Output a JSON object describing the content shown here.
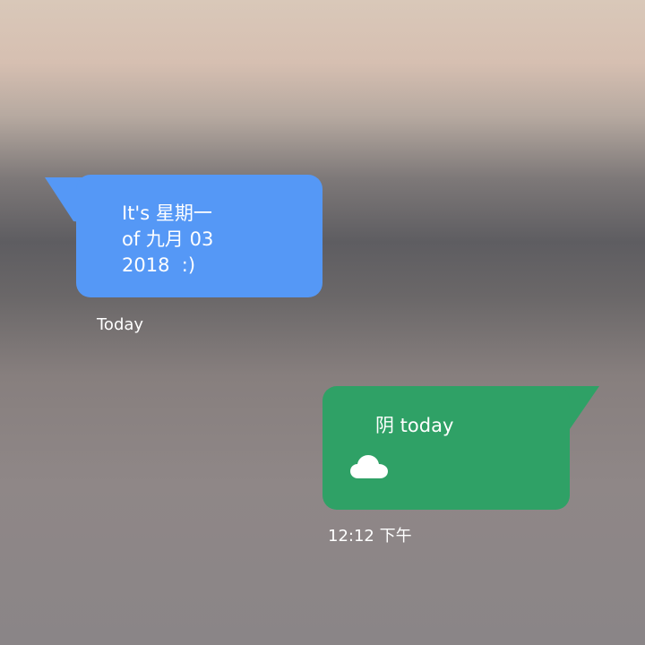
{
  "messages": [
    {
      "direction": "incoming",
      "text": "It's 星期一\nof 九月 03\n2018  :)",
      "color": "#5598f6",
      "timestamp": "Today"
    },
    {
      "direction": "outgoing",
      "text": "阴 today",
      "icon": "cloud-icon",
      "color": "#2fa166",
      "timestamp": "12:12 下午"
    }
  ]
}
